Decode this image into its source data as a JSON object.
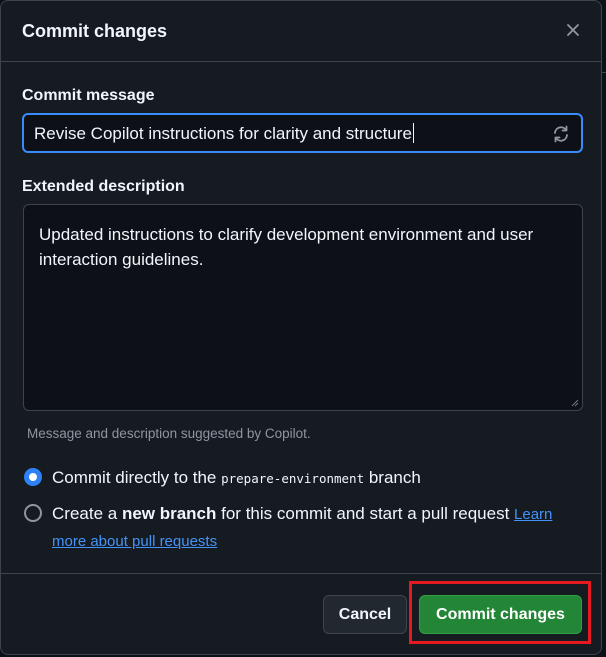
{
  "dialog": {
    "title": "Commit changes",
    "close_icon": "close-icon"
  },
  "commit_message": {
    "label": "Commit message",
    "value": "Revise Copilot instructions for clarity and structure",
    "refresh_icon": "refresh-icon"
  },
  "extended_description": {
    "label": "Extended description",
    "value": "Updated instructions to clarify development environment and user interaction guidelines."
  },
  "hint": "Message and description suggested by Copilot.",
  "options": {
    "direct": {
      "before": "Commit directly to the ",
      "branch": "prepare-environment",
      "after": " branch",
      "selected": true
    },
    "new_branch": {
      "before": "Create a ",
      "bold": "new branch",
      "after": " for this commit and start a pull request ",
      "link": "Learn more about pull requests",
      "selected": false
    }
  },
  "buttons": {
    "cancel": "Cancel",
    "commit": "Commit changes"
  },
  "colors": {
    "accent": "#2f81f7",
    "commit_button": "#238636",
    "highlight": "#e5191f"
  }
}
